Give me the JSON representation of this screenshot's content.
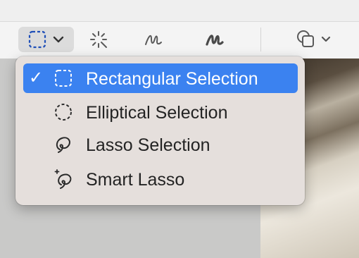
{
  "toolbar": {
    "tools": [
      {
        "icon": "rectangular-selection-icon"
      },
      {
        "icon": "magic-wand-icon"
      },
      {
        "icon": "sketch-icon"
      },
      {
        "icon": "draw-icon"
      },
      {
        "icon": "shapes-icon"
      }
    ],
    "active_tool": "rectangular-selection"
  },
  "selection_menu": {
    "items": [
      {
        "label": "Rectangular Selection",
        "icon": "rectangular-selection-icon",
        "checked": "✓"
      },
      {
        "label": "Elliptical Selection",
        "icon": "elliptical-selection-icon"
      },
      {
        "label": "Lasso Selection",
        "icon": "lasso-icon"
      },
      {
        "label": "Smart Lasso",
        "icon": "smart-lasso-icon"
      }
    ]
  },
  "colors": {
    "accent": "#3b82f0",
    "toolbar_icon": "#5a5a5a",
    "active_tool_icon": "#1f4fb8",
    "menu_background": "#e5dfdc"
  }
}
